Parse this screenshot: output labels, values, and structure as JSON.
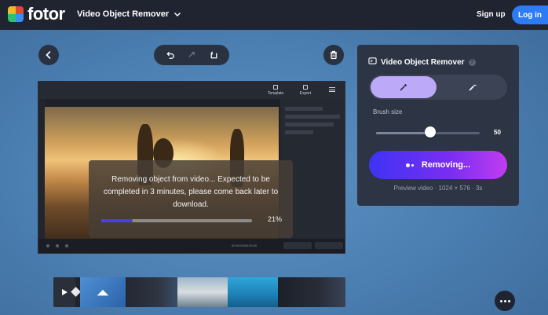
{
  "header": {
    "brand": "fotor",
    "tool_menu": "Video Object Remover",
    "signup": "Sign up",
    "login": "Log in"
  },
  "toolbar": {
    "icons": [
      "back-arrow-icon",
      "undo-icon",
      "redo-icon",
      "reset-icon",
      "trash-icon"
    ]
  },
  "preview": {
    "editor_buttons": [
      "Template",
      "Export"
    ],
    "timecode": "00:00:00/00:00:00",
    "overlay_message": "Removing object from video... Expected to be completed in 3 minutes, please come back later to download.",
    "progress_percent": 21,
    "progress_label": "21%"
  },
  "panel": {
    "title": "Video Object Remover",
    "help": "?",
    "modes": [
      {
        "name": "brush-add",
        "icon": "brush-add-icon",
        "active": true
      },
      {
        "name": "brush-erase",
        "icon": "eraser-icon",
        "active": false
      }
    ],
    "brush_label": "Brush size",
    "brush_value": 50,
    "brush_value_text": "50",
    "brush_min": 0,
    "brush_max": 100,
    "action_label": "Removing...",
    "preview_info": "Preview video · 1024 × 576 · 3s"
  },
  "colors": {
    "header_bg": "#1f2430",
    "accent_blue": "#2d7cf6",
    "progress_fill": "#4b3cf0",
    "toggle_active": "#bca9f8",
    "button_gradient_start": "#3f33f4",
    "button_gradient_end": "#c13df0"
  }
}
